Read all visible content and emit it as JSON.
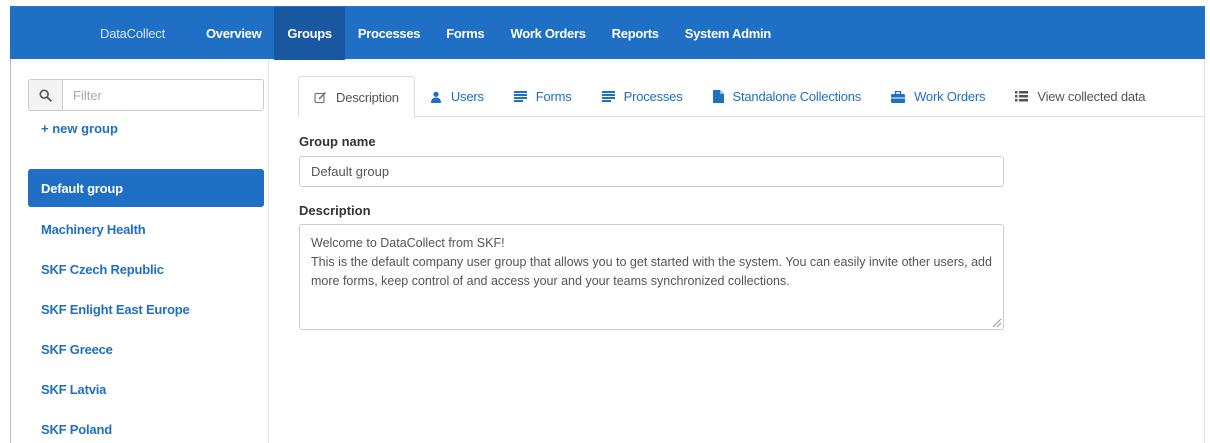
{
  "navbar": {
    "brand": "DataCollect",
    "items": [
      {
        "label": "Overview",
        "active": false
      },
      {
        "label": "Groups",
        "active": true
      },
      {
        "label": "Processes",
        "active": false
      },
      {
        "label": "Forms",
        "active": false
      },
      {
        "label": "Work Orders",
        "active": false
      },
      {
        "label": "Reports",
        "active": false
      },
      {
        "label": "System Admin",
        "active": false
      }
    ]
  },
  "sidebar": {
    "filter_placeholder": "Filter",
    "new_group_label": "+ new group",
    "groups": [
      {
        "label": "Default group",
        "active": true
      },
      {
        "label": "Machinery Health",
        "active": false
      },
      {
        "label": "SKF Czech Republic",
        "active": false
      },
      {
        "label": "SKF Enlight East Europe",
        "active": false
      },
      {
        "label": "SKF Greece",
        "active": false
      },
      {
        "label": "SKF Latvia",
        "active": false
      },
      {
        "label": "SKF Poland",
        "active": false
      }
    ]
  },
  "tabs": [
    {
      "label": "Description",
      "icon": "edit-icon",
      "active": true
    },
    {
      "label": "Users",
      "icon": "user-icon",
      "active": false
    },
    {
      "label": "Forms",
      "icon": "list-icon",
      "active": false
    },
    {
      "label": "Processes",
      "icon": "list-icon",
      "active": false
    },
    {
      "label": "Standalone Collections",
      "icon": "file-icon",
      "active": false
    },
    {
      "label": "Work Orders",
      "icon": "briefcase-icon",
      "active": false
    },
    {
      "label": "View collected data",
      "icon": "list-bullets-icon",
      "active": false
    }
  ],
  "form": {
    "group_name_label": "Group name",
    "group_name_value": "Default group",
    "description_label": "Description",
    "description_value": "Welcome to DataCollect from SKF!\nThis is the default company user group that allows you to get started with the system. You can easily invite other users, add more forms, keep control of and access your and your teams synchronized collections."
  },
  "colors": {
    "brand_blue": "#1f6fc5",
    "navbar_active": "#1958a0",
    "link_blue": "#1f6fc5"
  }
}
